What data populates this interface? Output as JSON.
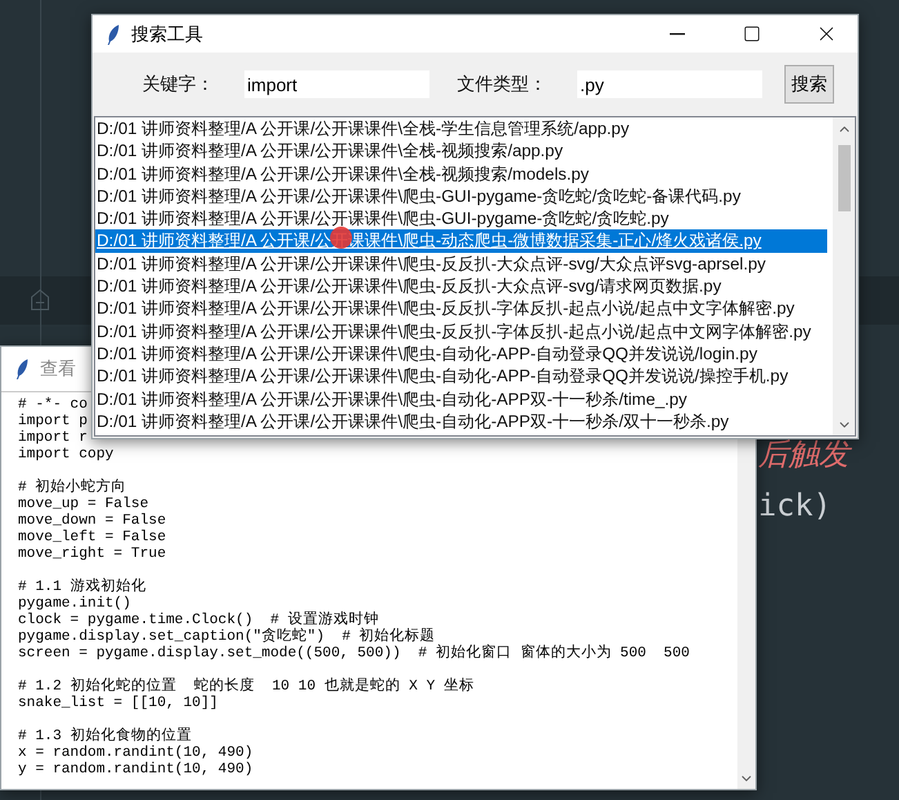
{
  "editor": {
    "texts": [
      {
        "kind": "comment",
        "text": "后触发"
      },
      {
        "kind": "code",
        "text": "ick)"
      }
    ]
  },
  "code_window": {
    "title": "查看",
    "blocks": [
      [
        "# -*- co",
        "import p",
        "import r",
        "import copy"
      ],
      [
        "# 初始小蛇方向",
        "move_up = False",
        "move_down = False",
        "move_left = False",
        "move_right = True"
      ],
      [
        "# 1.1 游戏初始化",
        "pygame.init()",
        "clock = pygame.time.Clock()  # 设置游戏时钟",
        "pygame.display.set_caption(\"贪吃蛇\")  # 初始化标题",
        "screen = pygame.display.set_mode((500, 500))  # 初始化窗口 窗体的大小为 500  500"
      ],
      [
        "# 1.2 初始化蛇的位置  蛇的长度  10 10 也就是蛇的 X Y 坐标",
        "snake_list = [[10, 10]]"
      ],
      [
        "# 1.3 初始化食物的位置",
        "x = random.randint(10, 490)",
        "y = random.randint(10, 490)"
      ]
    ]
  },
  "search_window": {
    "title": "搜索工具",
    "keyword": {
      "label": "关键字：",
      "value": "import"
    },
    "file_type": {
      "label": "文件类型：",
      "value": ".py"
    },
    "search_button": "搜索",
    "results": [
      {
        "path": "D:/01 讲师资料整理/A 公开课/公开课课件\\全栈-学生信息管理系统/app.py",
        "selected": false
      },
      {
        "path": "D:/01 讲师资料整理/A 公开课/公开课课件\\全栈-视频搜索/app.py",
        "selected": false
      },
      {
        "path": "D:/01 讲师资料整理/A 公开课/公开课课件\\全栈-视频搜索/models.py",
        "selected": false
      },
      {
        "path": "D:/01 讲师资料整理/A 公开课/公开课课件\\爬虫-GUI-pygame-贪吃蛇/贪吃蛇-备课代码.py",
        "selected": false
      },
      {
        "path": "D:/01 讲师资料整理/A 公开课/公开课课件\\爬虫-GUI-pygame-贪吃蛇/贪吃蛇.py",
        "selected": false
      },
      {
        "path": "D:/01 讲师资料整理/A 公开课/公开课课件\\爬虫-动态爬虫-微博数据采集-正心/烽火戏诸侯.py",
        "selected": true
      },
      {
        "path": "D:/01 讲师资料整理/A 公开课/公开课课件\\爬虫-反反扒-大众点评-svg/大众点评svg-aprsel.py",
        "selected": false
      },
      {
        "path": "D:/01 讲师资料整理/A 公开课/公开课课件\\爬虫-反反扒-大众点评-svg/请求网页数据.py",
        "selected": false
      },
      {
        "path": "D:/01 讲师资料整理/A 公开课/公开课课件\\爬虫-反反扒-字体反扒-起点小说/起点中文字体解密.py",
        "selected": false
      },
      {
        "path": "D:/01 讲师资料整理/A 公开课/公开课课件\\爬虫-反反扒-字体反扒-起点小说/起点中文网字体解密.py",
        "selected": false
      },
      {
        "path": "D:/01 讲师资料整理/A 公开课/公开课课件\\爬虫-自动化-APP-自动登录QQ并发说说/login.py",
        "selected": false
      },
      {
        "path": "D:/01 讲师资料整理/A 公开课/公开课课件\\爬虫-自动化-APP-自动登录QQ并发说说/操控手机.py",
        "selected": false
      },
      {
        "path": "D:/01 讲师资料整理/A 公开课/公开课课件\\爬虫-自动化-APP双-十一秒杀/time_.py",
        "selected": false
      },
      {
        "path": "D:/01 讲师资料整理/A 公开课/公开课课件\\爬虫-自动化-APP双-十一秒杀/双十一秒杀.py",
        "selected": false
      }
    ]
  }
}
